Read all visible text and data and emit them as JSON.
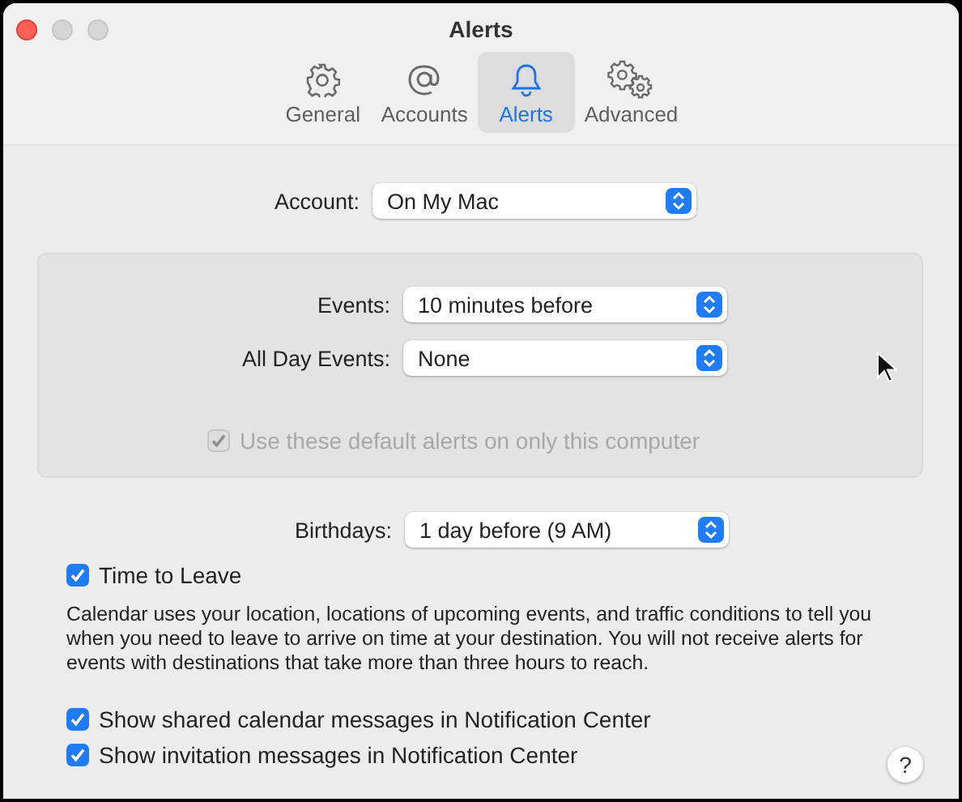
{
  "window": {
    "title": "Alerts"
  },
  "toolbar": [
    {
      "label": "General",
      "kind": "gear",
      "selected": false
    },
    {
      "label": "Accounts",
      "kind": "at",
      "selected": false
    },
    {
      "label": "Alerts",
      "kind": "bell",
      "selected": true
    },
    {
      "label": "Advanced",
      "kind": "gears",
      "selected": false
    }
  ],
  "account": {
    "label": "Account:",
    "value": "On My Mac"
  },
  "defaults": {
    "popups": [
      {
        "label": "Events:",
        "value": "10 minutes before"
      },
      {
        "label": "All Day Events:",
        "value": "None"
      }
    ],
    "checkbox": {
      "label": "Use these default alerts on only this computer",
      "checked": true,
      "disabled": true
    }
  },
  "birthdays": {
    "label": "Birthdays:",
    "value": "1 day before (9 AM)"
  },
  "time_to_leave": {
    "label": "Time to Leave",
    "checked": true,
    "disabled": false,
    "description": "Calendar uses your location, locations of upcoming events, and traffic conditions to tell you when you need to leave to arrive on time at your destination. You will not receive alerts for events with destinations that take more than three hours to reach."
  },
  "options": [
    {
      "label": "Show shared calendar messages in Notification Center",
      "checked": true,
      "disabled": false
    },
    {
      "label": "Show invitation messages in Notification Center",
      "checked": true,
      "disabled": false
    }
  ],
  "help": {
    "label": "?"
  }
}
